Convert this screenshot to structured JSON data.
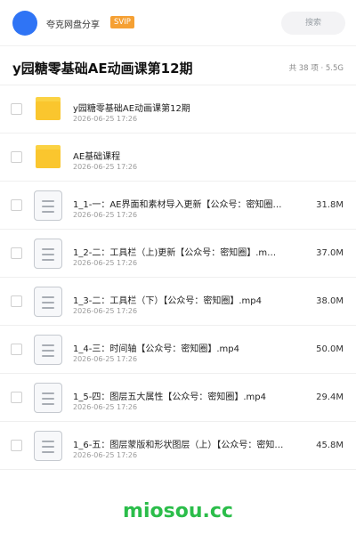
{
  "header": {
    "share_name": "夸克网盘分享",
    "badge": "SVIP",
    "search_placeholder": "搜索"
  },
  "title_row": {
    "title": "y园糖零基础AE动画课第12期",
    "summary": "共 38 项 · 5.5G"
  },
  "items": [
    {
      "type": "folder",
      "name": "y园糖零基础AE动画课第12期",
      "date": "2026-06-25 17:26",
      "size": ""
    },
    {
      "type": "folder",
      "name": "AE基础课程",
      "date": "2026-06-25 17:26",
      "size": ""
    },
    {
      "type": "file",
      "name": "1_1-一：AE界面和素材导入更新【公众号：密知圈…",
      "date": "2026-06-25 17:26",
      "size": "31.8M"
    },
    {
      "type": "file",
      "name": "1_2-二：工具栏（上)更新【公众号：密知圈】.m…",
      "date": "2026-06-25 17:26",
      "size": "37.0M"
    },
    {
      "type": "file",
      "name": "1_3-二：工具栏（下）【公众号：密知圈】.mp4",
      "date": "2026-06-25 17:26",
      "size": "38.0M"
    },
    {
      "type": "file",
      "name": "1_4-三：时间轴【公众号：密知圈】.mp4",
      "date": "2026-06-25 17:26",
      "size": "50.0M"
    },
    {
      "type": "file",
      "name": "1_5-四：图层五大属性【公众号：密知圈】.mp4",
      "date": "2026-06-25 17:26",
      "size": "29.4M"
    },
    {
      "type": "file",
      "name": "1_6-五：图层蒙版和形状图层（上）【公众号：密知…",
      "date": "2026-06-25 17:26",
      "size": "45.8M"
    }
  ],
  "watermark": "miosou.cc",
  "colors": {
    "avatar": "#2f74f5",
    "svip": "#f5a033",
    "folder": "#fac62e",
    "watermark": "#2bbd4a"
  }
}
